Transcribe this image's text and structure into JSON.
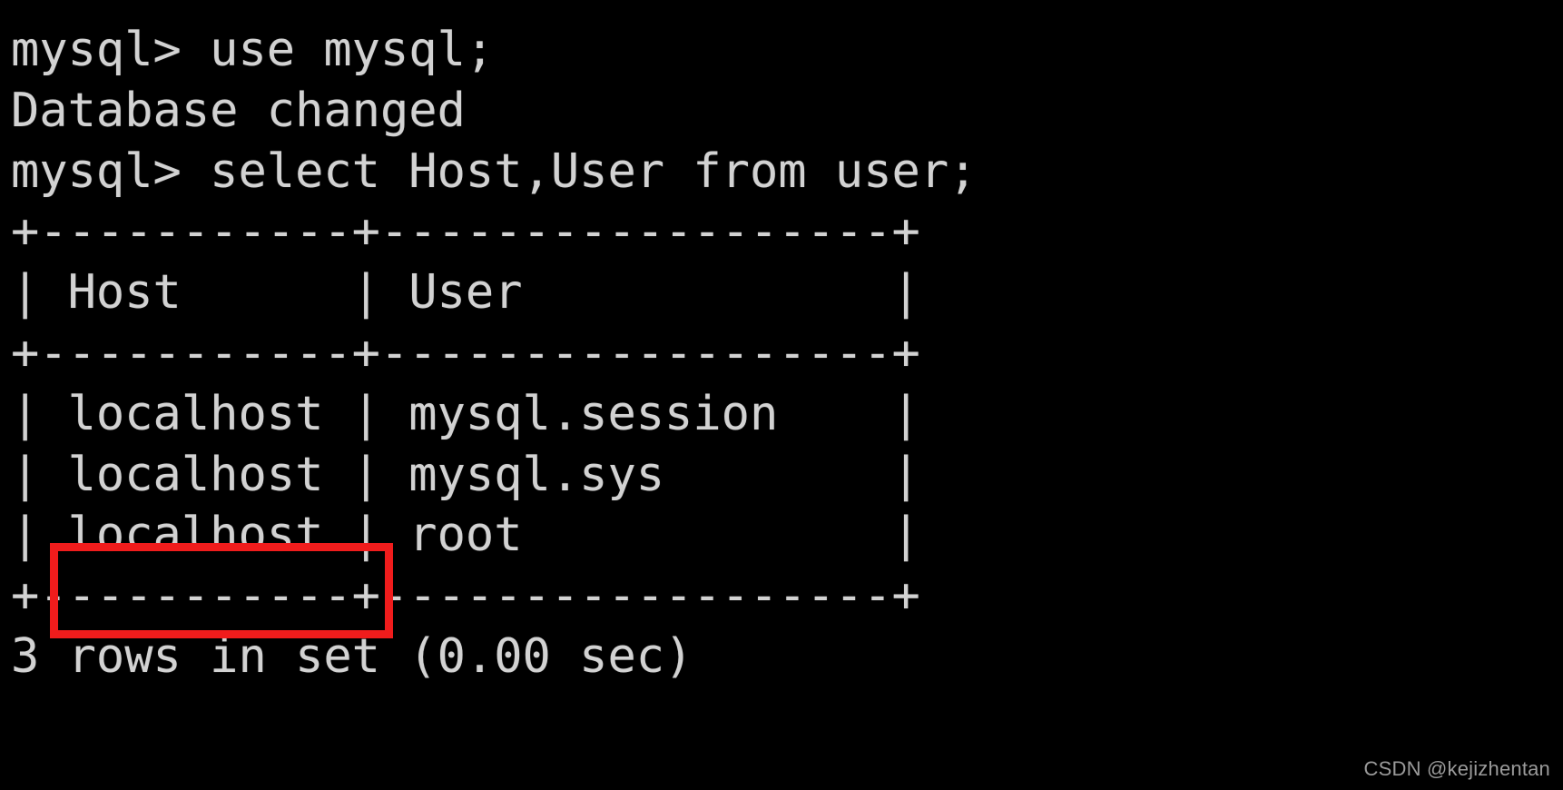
{
  "terminal": {
    "background_color": "#000000",
    "foreground_color": "#d2d2d2",
    "highlight_color": "#f01c1c",
    "lines": [
      {
        "id": "prompt-use-db",
        "text": "mysql> use mysql;"
      },
      {
        "id": "database-changed",
        "text": "Database changed"
      },
      {
        "id": "prompt-select",
        "text": "mysql> select Host,User from user;"
      },
      {
        "id": "table-top-border",
        "text": "+-----------+------------------+"
      },
      {
        "id": "table-header-row",
        "text": "| Host      | User             |"
      },
      {
        "id": "table-header-sep",
        "text": "+-----------+------------------+"
      },
      {
        "id": "table-row-1",
        "text": "| localhost | mysql.session    |"
      },
      {
        "id": "table-row-2",
        "text": "| localhost | mysql.sys        |"
      },
      {
        "id": "table-row-3",
        "text": "| localhost | root             |"
      },
      {
        "id": "table-bottom-border",
        "text": "+-----------+------------------+"
      },
      {
        "id": "result-status",
        "text": "3 rows in set (0.00 sec)"
      }
    ]
  },
  "query_result": {
    "columns": [
      "Host",
      "User"
    ],
    "rows": [
      [
        "localhost",
        "mysql.session"
      ],
      [
        "localhost",
        "mysql.sys"
      ],
      [
        "localhost",
        "root"
      ]
    ],
    "row_count_text": "3 rows in set (0.00 sec)",
    "highlighted_cell": "localhost"
  },
  "watermark": {
    "text": "CSDN @kejizhentan"
  }
}
